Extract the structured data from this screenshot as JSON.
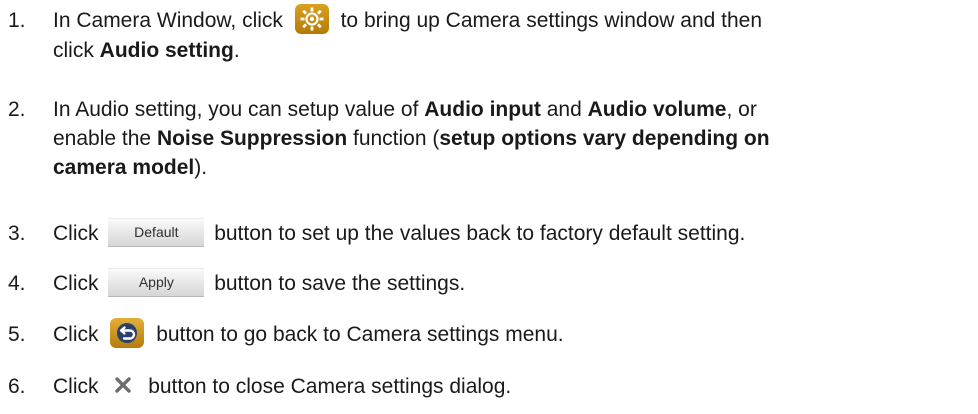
{
  "steps": [
    {
      "num": "1.",
      "line1_pre": "In Camera Window, click",
      "line1_post": "to bring up Camera settings window and then",
      "line2_pre": "click ",
      "line2_bold": "Audio setting",
      "line2_post": ".",
      "icon": "settings-gear-icon"
    },
    {
      "num": "2.",
      "p1": "In Audio setting, you can setup value of ",
      "b1": "Audio input",
      "p2": " and ",
      "b2": "Audio volume",
      "p3": ", or",
      "p4": "enable the ",
      "b3": "Noise Suppression",
      "p5": " function (",
      "b4": "setup options vary depending on",
      "b5": "camera model",
      "p6": ")."
    },
    {
      "num": "3.",
      "pre": "Click",
      "button_label": "Default",
      "post": "button to set up the values back to factory default setting."
    },
    {
      "num": "4.",
      "pre": "Click",
      "button_label": "Apply",
      "post": "button to save the settings."
    },
    {
      "num": "5.",
      "pre": "Click",
      "post": "button to go back to Camera settings menu.",
      "icon": "back-arrow-icon"
    },
    {
      "num": "6.",
      "pre": "Click",
      "post": "button to close Camera settings dialog.",
      "icon": "close-x-icon"
    }
  ],
  "colors": {
    "icon_gold": "#c98f12",
    "icon_navy": "#2b3f6b",
    "close_gray": "#6e6e6e",
    "text": "#1a1a1a"
  }
}
